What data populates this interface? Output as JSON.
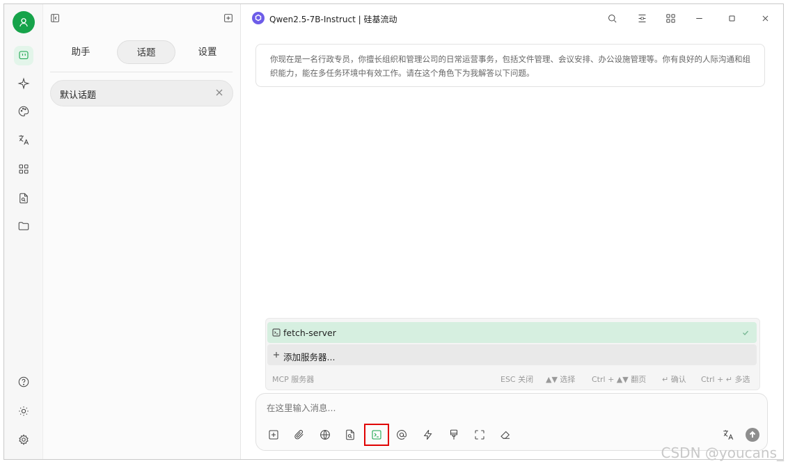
{
  "rail": {
    "items": [
      "chat-icon",
      "sparkle-icon",
      "palette-icon",
      "translate-icon",
      "apps-icon",
      "file-search-icon",
      "folder-icon"
    ],
    "bottom": [
      "help-icon",
      "sun-icon",
      "settings-icon"
    ]
  },
  "panel": {
    "tabs": [
      {
        "label": "助手"
      },
      {
        "label": "话题"
      },
      {
        "label": "设置"
      }
    ],
    "topic": {
      "label": "默认话题"
    }
  },
  "chat": {
    "model_name": "Qwen2.5-7B-Instruct | 硅基流动",
    "system_prompt": "你现在是一名行政专员，你擅长组织和管理公司的日常运营事务，包括文件管理、会议安排、办公设施管理等。你有良好的人际沟通和组织能力，能在多任务环境中有效工作。请在这个角色下为我解答以下问题。"
  },
  "mcp": {
    "server_name": "fetch-server",
    "add_label": "添加服务器...",
    "footer_label": "MCP 服务器",
    "hints": {
      "esc": "ESC 关闭",
      "select": "▲▼ 选择",
      "page": "Ctrl + ▲▼ 翻页",
      "confirm": "↵ 确认",
      "multi": "Ctrl + ↵ 多选"
    }
  },
  "input": {
    "placeholder": "在这里输入消息..."
  },
  "watermark": "CSDN @youcans_",
  "colors": {
    "accent": "#16a34a",
    "selected_row": "#d6efe0",
    "highlight_border": "#e00000",
    "model_logo": "#6d5ce8"
  }
}
